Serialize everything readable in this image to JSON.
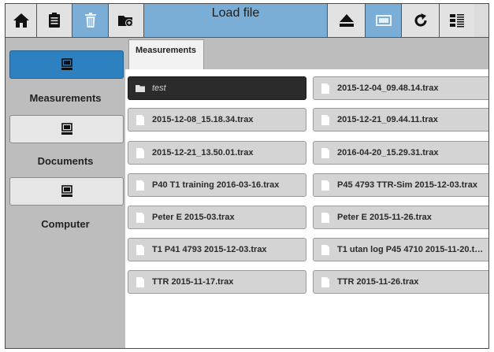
{
  "toolbar": {
    "title": "Load file",
    "buttons": [
      {
        "id": "home",
        "icon": "home-icon"
      },
      {
        "id": "clipboard",
        "icon": "clipboard-icon"
      },
      {
        "id": "delete",
        "icon": "trash-icon"
      },
      {
        "id": "new-folder",
        "icon": "new-folder-icon"
      },
      {
        "id": "eject",
        "icon": "eject-icon"
      },
      {
        "id": "window",
        "icon": "window-icon"
      },
      {
        "id": "refresh",
        "icon": "refresh-icon"
      },
      {
        "id": "layout",
        "icon": "layout-icon"
      }
    ]
  },
  "sidebar": {
    "items": [
      {
        "label": "Measurements",
        "icon": "computer-icon",
        "active": true
      },
      {
        "label": "Documents",
        "icon": "computer-icon",
        "active": false
      },
      {
        "label": "Computer",
        "icon": "computer-icon",
        "active": false
      }
    ]
  },
  "tab": {
    "label": "Measurements"
  },
  "files": [
    {
      "name": "test",
      "type": "folder"
    },
    {
      "name": "2015-12-04_09.48.14.trax",
      "type": "file"
    },
    {
      "name": "2015-12-08_15.18.34.trax",
      "type": "file"
    },
    {
      "name": "2015-12-21_09.44.11.trax",
      "type": "file"
    },
    {
      "name": "2015-12-21_13.50.01.trax",
      "type": "file"
    },
    {
      "name": "2016-04-20_15.29.31.trax",
      "type": "file"
    },
    {
      "name": "P40 T1 training 2016-03-16.trax",
      "type": "file"
    },
    {
      "name": "P45 4793 TTR-Sim 2015-12-03.trax",
      "type": "file"
    },
    {
      "name": "Peter E 2015-03.trax",
      "type": "file"
    },
    {
      "name": "Peter E 2015-11-26.trax",
      "type": "file"
    },
    {
      "name": "T1 P41 4793 2015-12-03.trax",
      "type": "file"
    },
    {
      "name": "T1 utan log P45 4710 2015-11-20.t…",
      "type": "file"
    },
    {
      "name": "TTR 2015-11-17.trax",
      "type": "file"
    },
    {
      "name": "TTR 2015-11-26.trax",
      "type": "file"
    }
  ]
}
